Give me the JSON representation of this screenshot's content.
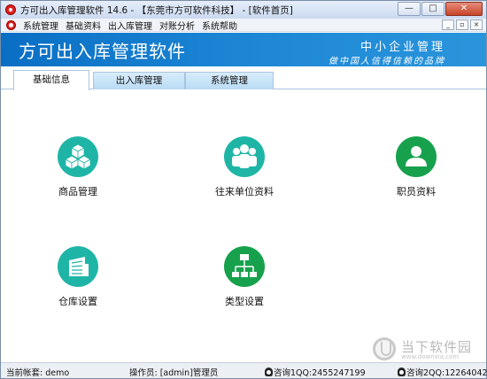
{
  "window": {
    "title": "方可出入库管理软件 14.6 - 【东莞市方可软件科技】 - [软件首页]",
    "controls": {
      "minimize": "—",
      "maximize": "□",
      "close": "✕"
    }
  },
  "menu": {
    "items": [
      "系统管理",
      "基础资料",
      "出入库管理",
      "对账分析",
      "系统帮助"
    ],
    "mdi": {
      "minimize": "_",
      "restore": "▫",
      "close": "×"
    }
  },
  "banner": {
    "title": "方可出入库管理软件",
    "slogan_line1": "中小企业管理",
    "slogan_line2": "做中国人信得信赖的品牌"
  },
  "tabs": [
    {
      "label": "基础信息",
      "active": true
    },
    {
      "label": "出入库管理",
      "active": false
    },
    {
      "label": "系统管理",
      "active": false
    }
  ],
  "tiles": [
    {
      "label": "商品管理",
      "icon": "cubes-icon",
      "color": "#1fb5a6"
    },
    {
      "label": "往来单位资料",
      "icon": "people-group-icon",
      "color": "#1fb5a6"
    },
    {
      "label": "职员资料",
      "icon": "person-icon",
      "color": "#17a14c"
    },
    {
      "label": "仓库设置",
      "icon": "warehouse-icon",
      "color": "#1fb5a6"
    },
    {
      "label": "类型设置",
      "icon": "hierarchy-icon",
      "color": "#17a14c"
    }
  ],
  "watermark": {
    "text": "当下软件园",
    "url": "www.downxia.com"
  },
  "statusbar": {
    "account": "当前帐套: demo",
    "operator": "操作员: [admin]管理员",
    "qq1": "咨询1QQ:2455247199",
    "qq2": "咨询2QQ:12264042"
  }
}
